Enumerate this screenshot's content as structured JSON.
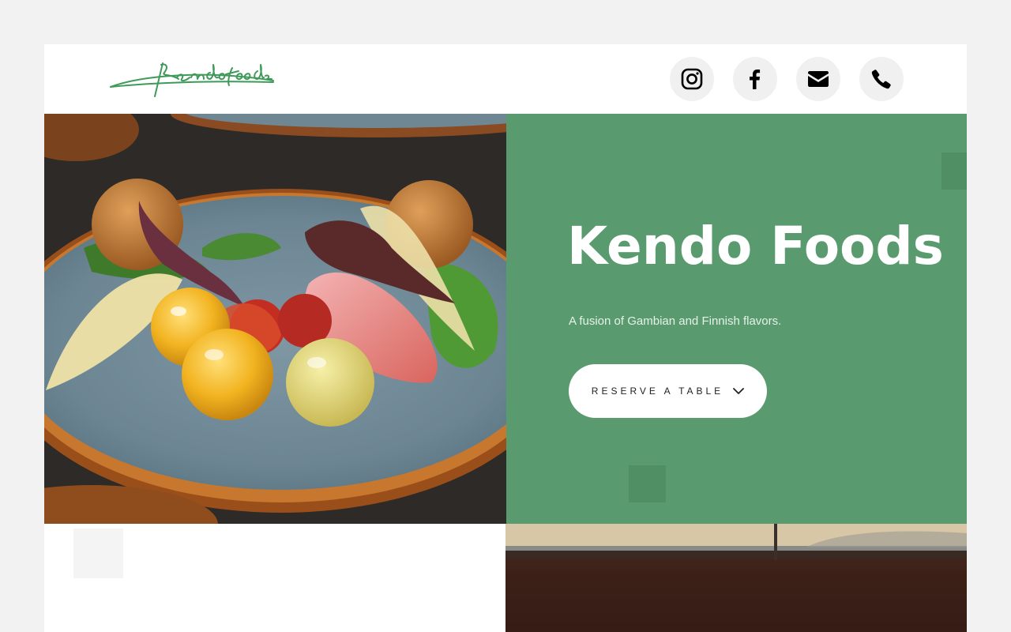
{
  "brand": {
    "logo_text": "Kendo Foods",
    "accent_color": "#599b6e",
    "logo_color": "#3f9a5a"
  },
  "header": {
    "social": [
      {
        "name": "instagram",
        "icon": "instagram-icon"
      },
      {
        "name": "facebook",
        "icon": "facebook-icon"
      },
      {
        "name": "email",
        "icon": "envelope-icon"
      },
      {
        "name": "phone",
        "icon": "phone-icon"
      }
    ]
  },
  "hero": {
    "title": "Kendo Foods",
    "subtitle": "A fusion of Gambian and Finnish flavors.",
    "cta_label": "RESERVE A TABLE",
    "cta_icon": "chevron-down-icon"
  }
}
